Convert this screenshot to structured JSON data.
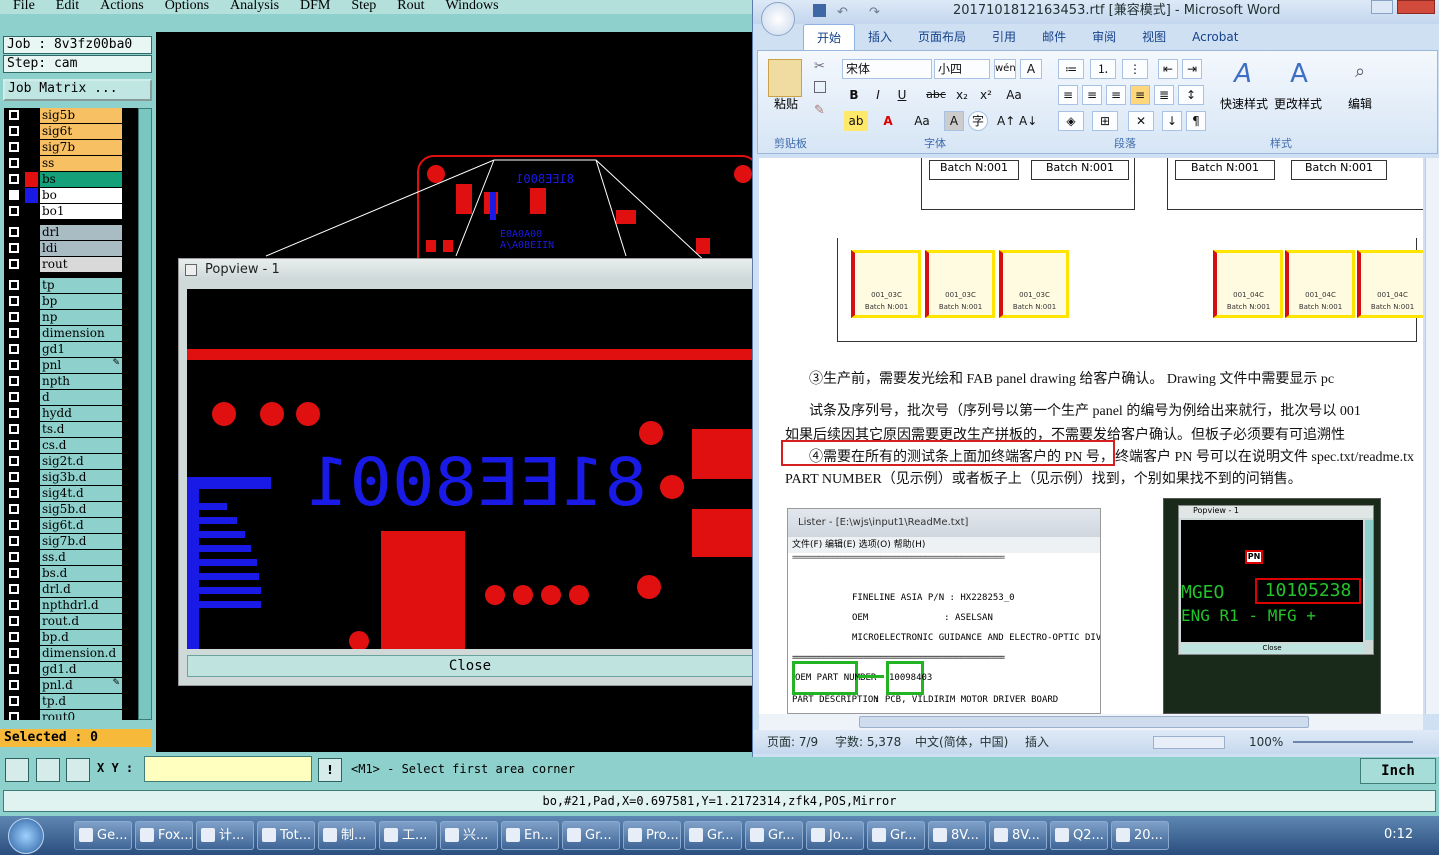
{
  "cam": {
    "menu": [
      "File",
      "Edit",
      "Actions",
      "Options",
      "Analysis",
      "DFM",
      "Step",
      "Rout",
      "Windows"
    ],
    "job": "Job : 8v3fz00ba0",
    "step": "Step: cam",
    "job_matrix": "Job Matrix ...",
    "layers": [
      {
        "name": "sig5b",
        "color": "#f7c062"
      },
      {
        "name": "sig6t",
        "color": "#f7c062"
      },
      {
        "name": "sig7b",
        "color": "#f7c062"
      },
      {
        "name": "ss",
        "color": "#f7c062"
      },
      {
        "name": "bs",
        "color": "#14a078",
        "swatch": "#e01010"
      },
      {
        "name": "bo",
        "color": "#ffffff",
        "swatch": "#1a1ae6",
        "selected": true
      },
      {
        "name": "bo1",
        "color": "#ffffff"
      },
      {
        "name": "drl",
        "color": "#a9bcc4"
      },
      {
        "name": "ldi",
        "color": "#a9bcc4"
      },
      {
        "name": "rout",
        "color": "#d9d9d9"
      },
      {
        "name": "tp",
        "color": "#8ed0cc"
      },
      {
        "name": "bp",
        "color": "#8ed0cc"
      },
      {
        "name": "np",
        "color": "#8ed0cc"
      },
      {
        "name": "dimension",
        "color": "#8ed0cc"
      },
      {
        "name": "gd1",
        "color": "#8ed0cc"
      },
      {
        "name": "pnl",
        "color": "#8ed0cc",
        "icon": true
      },
      {
        "name": "npth",
        "color": "#8ed0cc"
      },
      {
        "name": "d",
        "color": "#8ed0cc"
      },
      {
        "name": "hydd",
        "color": "#8ed0cc"
      },
      {
        "name": "ts.d",
        "color": "#8ed0cc"
      },
      {
        "name": "cs.d",
        "color": "#8ed0cc"
      },
      {
        "name": "sig2t.d",
        "color": "#8ed0cc"
      },
      {
        "name": "sig3b.d",
        "color": "#8ed0cc"
      },
      {
        "name": "sig4t.d",
        "color": "#8ed0cc"
      },
      {
        "name": "sig5b.d",
        "color": "#8ed0cc"
      },
      {
        "name": "sig6t.d",
        "color": "#8ed0cc"
      },
      {
        "name": "sig7b.d",
        "color": "#8ed0cc"
      },
      {
        "name": "ss.d",
        "color": "#8ed0cc"
      },
      {
        "name": "bs.d",
        "color": "#8ed0cc"
      },
      {
        "name": "drl.d",
        "color": "#8ed0cc"
      },
      {
        "name": "npthdrl.d",
        "color": "#8ed0cc"
      },
      {
        "name": "rout.d",
        "color": "#8ed0cc"
      },
      {
        "name": "bp.d",
        "color": "#8ed0cc"
      },
      {
        "name": "dimension.d",
        "color": "#8ed0cc"
      },
      {
        "name": "gd1.d",
        "color": "#8ed0cc"
      },
      {
        "name": "pnl.d",
        "color": "#8ed0cc",
        "icon": true
      },
      {
        "name": "tp.d",
        "color": "#8ed0cc"
      },
      {
        "name": "rout0",
        "color": "#8ed0cc"
      }
    ],
    "selected": "Selected : 0",
    "xy_label": "X Y :",
    "xy_value": "",
    "prompt": "<M1> - Select first area corner",
    "units": "Inch",
    "status": "bo,#21,Pad,X=0.697581,Y=1.2172314,zfk4,POS,Mirror",
    "board_text": "81EE8001",
    "board_text2": "E0A0A00",
    "board_text3": "A\\A0BEIIN",
    "popview": {
      "title": "Popview - 1",
      "pcb_text": "81EE8001",
      "close": "Close"
    }
  },
  "word": {
    "title": "2017101812163453.rtf [兼容模式] - Microsoft Word",
    "tabs": [
      "开始",
      "插入",
      "页面布局",
      "引用",
      "邮件",
      "审阅",
      "视图",
      "Acrobat"
    ],
    "font_name": "宋体",
    "font_size": "小四",
    "groups": {
      "clipboard": "剪贴板",
      "font": "字体",
      "paragraph": "段落",
      "styles": "样式",
      "edit": "编辑"
    },
    "paste": "粘贴",
    "quick_styles": "快速样式",
    "change_styles": "更改样式",
    "edit_btn": "编辑",
    "batch_label": "Batch N:001",
    "coupons_left": [
      "001_03C",
      "001_03C",
      "001_03C"
    ],
    "coupons_right": [
      "001_04C",
      "001_04C",
      "001_04C"
    ],
    "coupon_batch": "Batch N:001",
    "para3": "③生产前，需要发光绘和 FAB panel drawing 给客户确认。    Drawing 文件中需要显示 pc",
    "para3b": "试条及序列号，批次号（序列号以第一个生产 panel 的编号为例给出来就行，批次号以 001",
    "para3c": "如果后续因其它原因需要更改生产拼板的，不需要发给客户确认。但板子必须要有可追溯性",
    "para4a": "④需要在所有的测试条上面加终端客户的 PN 号，",
    "para4b": "终端客户 PN 号可以在说明文件 spec.txt/readme.tx",
    "para4c": "PART NUMBER（见示例）或者板子上（见示例）找到，个别如果找不到的问销售。",
    "lister": {
      "title": "Lister - [E:\\wjs\\input1\\ReadMe.txt]",
      "menu": "文件(F)  编辑(E)  选项(O)  帮助(H)",
      "l1": "FINELINE ASIA P/N : HX228253_0",
      "l2": "OEM              : ASELSAN",
      "l3": "MICROELECTRONIC GUIDANCE AND ELECTRO-OPTIC DIVISIO",
      "oem_pn": "OEM PART NUMBER",
      "pn_value": "10098403",
      "part_desc": "PART DESCRIPTION",
      "desc_value": ": PCB, VILDIRIM MOTOR DRIVER BOARD"
    },
    "popview_small": {
      "title": "Popview - 1",
      "pn_tag": "PN",
      "mgeo": "MGEO",
      "pn": "10105238",
      "eng": "ENG R1 - MFG +",
      "close": "Close"
    },
    "status": {
      "page": "页面: 7/9",
      "words": "字数: 5,378",
      "lang": "中文(简体，中国)",
      "mode": "插入",
      "zoom": "100%"
    }
  },
  "taskbar": {
    "items": [
      "Ge...",
      "Fox...",
      "计...",
      "Tot...",
      "制...",
      "工...",
      "兴...",
      "En...",
      "Gr...",
      "Pro...",
      "Gr...",
      "Gr...",
      "Jo...",
      "Gr...",
      "8V...",
      "8V...",
      "Q2...",
      "20..."
    ],
    "clock": "0:12"
  }
}
